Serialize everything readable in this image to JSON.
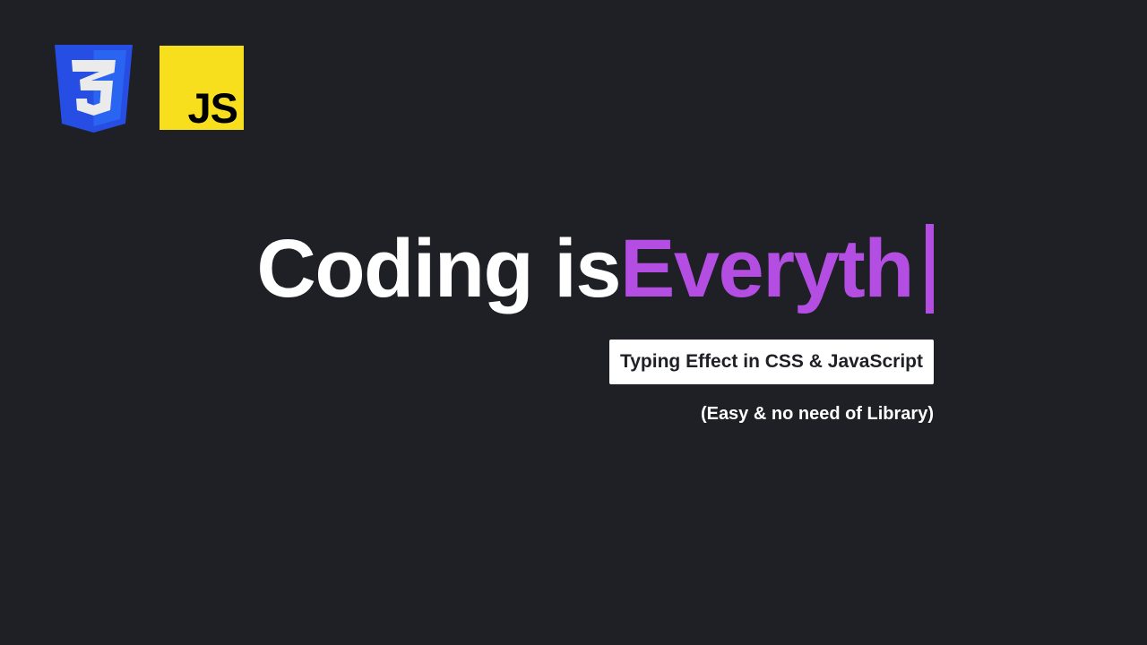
{
  "logos": {
    "css": {
      "icon": "css3-shield-icon",
      "color": "#264de4",
      "color_light": "#2965f1"
    },
    "js": {
      "label": "JS",
      "icon": "javascript-square-icon",
      "background": "#f7df1e",
      "text_color": "#000000"
    }
  },
  "headline": {
    "static_text": "Coding is ",
    "typed_text": "Everyth",
    "static_color": "#ffffff",
    "typed_color": "#b44ee3",
    "cursor_color": "#b44ee3"
  },
  "subtitle": {
    "text": "Typing Effect in CSS & JavaScript",
    "background": "#ffffff",
    "text_color": "#1f2026"
  },
  "note": {
    "text": "(Easy & no need of Library)"
  },
  "theme": {
    "background": "#1f2026"
  }
}
